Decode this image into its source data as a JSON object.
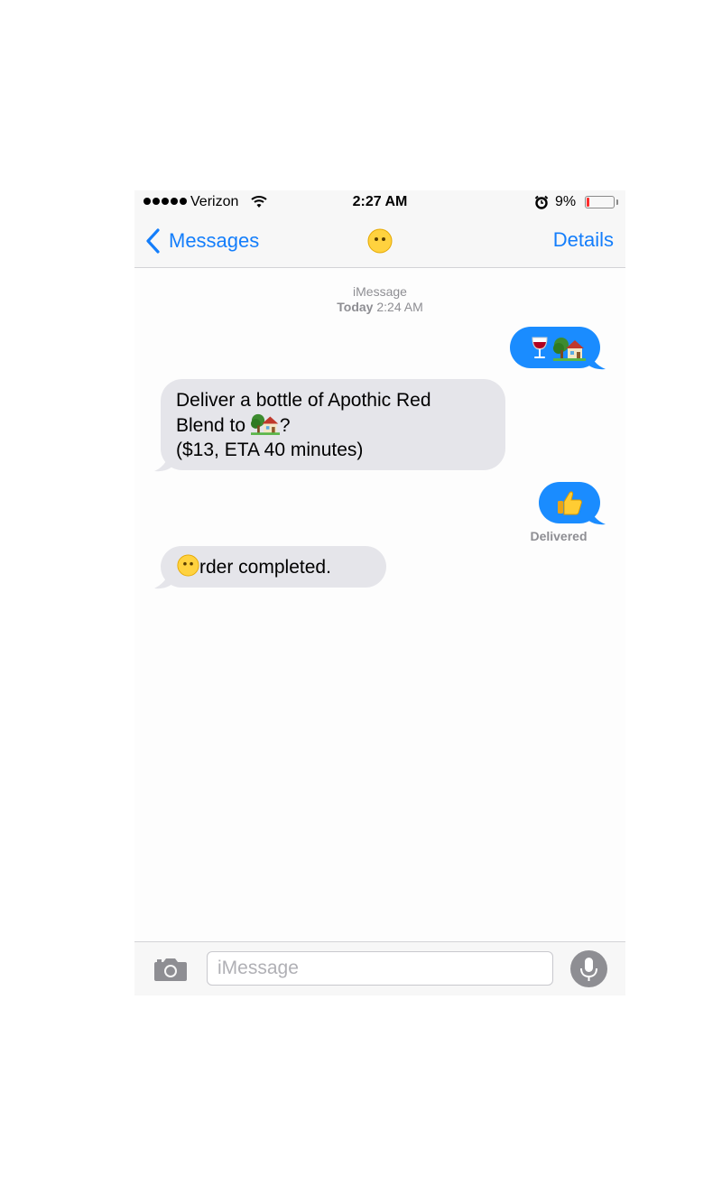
{
  "status_bar": {
    "carrier": "Verizon",
    "time": "2:27 AM",
    "battery_percent": "9%",
    "battery_level": 0.09,
    "icons": [
      "signal-dots-icon",
      "wifi-icon",
      "alarm-icon",
      "battery-icon"
    ]
  },
  "nav": {
    "back_label": "Messages",
    "details_label": "Details",
    "contact_avatar_icon": "smiley-face-icon"
  },
  "conversation": {
    "service": "iMessage",
    "timestamp_day": "Today",
    "timestamp_time": "2:24 AM",
    "messages": [
      {
        "direction": "outgoing",
        "icons": [
          "wine-glass-icon",
          "house-with-garden-icon"
        ]
      },
      {
        "direction": "incoming",
        "line1": "Deliver a bottle of Apothic Red",
        "line2_prefix": "Blend to ",
        "line2_suffix": "?",
        "line3": "($13, ETA 40 minutes)"
      },
      {
        "direction": "outgoing",
        "icons": [
          "thumbs-up-icon"
        ]
      },
      {
        "direction": "incoming",
        "text": "rder completed."
      }
    ],
    "delivered_label": "Delivered"
  },
  "input_bar": {
    "placeholder": "iMessage",
    "value": "",
    "icons": [
      "camera-icon",
      "microphone-icon"
    ]
  },
  "colors": {
    "ios_blue": "#147efb",
    "outgoing_bubble": "#1a8cff",
    "incoming_bubble": "#e5e5ea",
    "battery_low": "#ff2d2d"
  }
}
